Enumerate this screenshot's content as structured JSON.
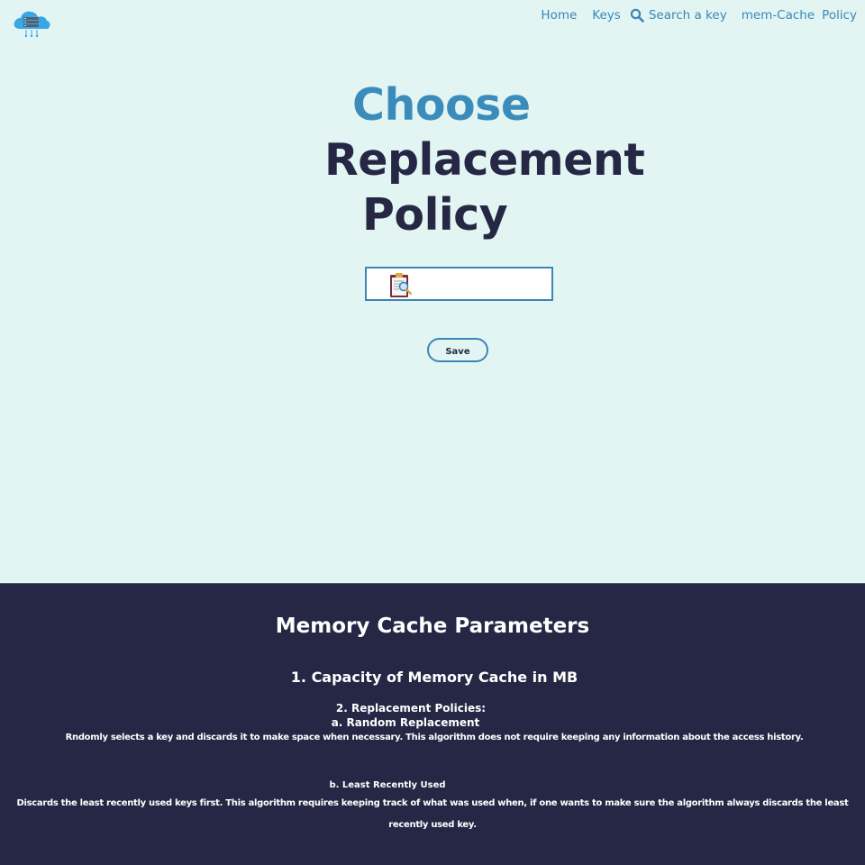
{
  "header": {
    "logo_icon": "cloud-server-icon",
    "nav": {
      "home_label": "Home",
      "keys_label": "Keys",
      "search_icon": "search-icon",
      "search_label": "Search a key",
      "memcache_label": "mem-Cache",
      "policy_label": "Policy"
    }
  },
  "main": {
    "title_line1": "Choose",
    "title_line2": "Replacement",
    "title_line3": "Policy",
    "policy_select": {
      "icon": "clipboard-search-icon",
      "selected_value": ""
    },
    "save_label": "Save"
  },
  "info": {
    "heading": "Memory Cache Parameters",
    "capacity": "1. Capacity of Memory Cache in MB",
    "policies_title": "2. Replacement Policies:",
    "random_title": "a. Random Replacement",
    "random_desc": "Rndomly selects a key and discards it to make space when necessary. This algorithm does not require keeping any information about the access history.",
    "lru_title": "b. Least Recently Used",
    "lru_desc": "Discards the least recently used keys first. This algorithm requires keeping track of what was used when, if one wants to make sure the algorithm always discards the least recently used key."
  },
  "colors": {
    "page_background": "#e2f5f3",
    "accent_blue": "#3b8cbb",
    "dark_navy": "#252744",
    "info_text": "#ffffff"
  }
}
